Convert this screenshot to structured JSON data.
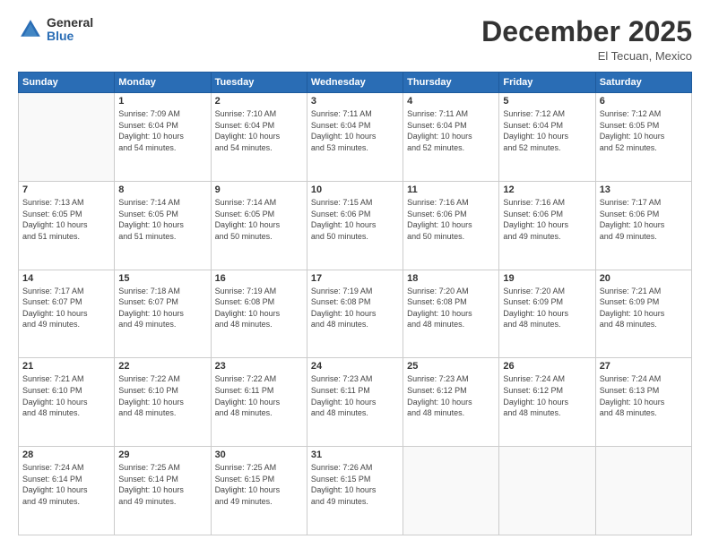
{
  "logo": {
    "general": "General",
    "blue": "Blue"
  },
  "title": "December 2025",
  "subtitle": "El Tecuan, Mexico",
  "header_days": [
    "Sunday",
    "Monday",
    "Tuesday",
    "Wednesday",
    "Thursday",
    "Friday",
    "Saturday"
  ],
  "weeks": [
    [
      {
        "day": "",
        "info": ""
      },
      {
        "day": "1",
        "info": "Sunrise: 7:09 AM\nSunset: 6:04 PM\nDaylight: 10 hours\nand 54 minutes."
      },
      {
        "day": "2",
        "info": "Sunrise: 7:10 AM\nSunset: 6:04 PM\nDaylight: 10 hours\nand 54 minutes."
      },
      {
        "day": "3",
        "info": "Sunrise: 7:11 AM\nSunset: 6:04 PM\nDaylight: 10 hours\nand 53 minutes."
      },
      {
        "day": "4",
        "info": "Sunrise: 7:11 AM\nSunset: 6:04 PM\nDaylight: 10 hours\nand 52 minutes."
      },
      {
        "day": "5",
        "info": "Sunrise: 7:12 AM\nSunset: 6:04 PM\nDaylight: 10 hours\nand 52 minutes."
      },
      {
        "day": "6",
        "info": "Sunrise: 7:12 AM\nSunset: 6:05 PM\nDaylight: 10 hours\nand 52 minutes."
      }
    ],
    [
      {
        "day": "7",
        "info": "Sunrise: 7:13 AM\nSunset: 6:05 PM\nDaylight: 10 hours\nand 51 minutes."
      },
      {
        "day": "8",
        "info": "Sunrise: 7:14 AM\nSunset: 6:05 PM\nDaylight: 10 hours\nand 51 minutes."
      },
      {
        "day": "9",
        "info": "Sunrise: 7:14 AM\nSunset: 6:05 PM\nDaylight: 10 hours\nand 50 minutes."
      },
      {
        "day": "10",
        "info": "Sunrise: 7:15 AM\nSunset: 6:06 PM\nDaylight: 10 hours\nand 50 minutes."
      },
      {
        "day": "11",
        "info": "Sunrise: 7:16 AM\nSunset: 6:06 PM\nDaylight: 10 hours\nand 50 minutes."
      },
      {
        "day": "12",
        "info": "Sunrise: 7:16 AM\nSunset: 6:06 PM\nDaylight: 10 hours\nand 49 minutes."
      },
      {
        "day": "13",
        "info": "Sunrise: 7:17 AM\nSunset: 6:06 PM\nDaylight: 10 hours\nand 49 minutes."
      }
    ],
    [
      {
        "day": "14",
        "info": "Sunrise: 7:17 AM\nSunset: 6:07 PM\nDaylight: 10 hours\nand 49 minutes."
      },
      {
        "day": "15",
        "info": "Sunrise: 7:18 AM\nSunset: 6:07 PM\nDaylight: 10 hours\nand 49 minutes."
      },
      {
        "day": "16",
        "info": "Sunrise: 7:19 AM\nSunset: 6:08 PM\nDaylight: 10 hours\nand 48 minutes."
      },
      {
        "day": "17",
        "info": "Sunrise: 7:19 AM\nSunset: 6:08 PM\nDaylight: 10 hours\nand 48 minutes."
      },
      {
        "day": "18",
        "info": "Sunrise: 7:20 AM\nSunset: 6:08 PM\nDaylight: 10 hours\nand 48 minutes."
      },
      {
        "day": "19",
        "info": "Sunrise: 7:20 AM\nSunset: 6:09 PM\nDaylight: 10 hours\nand 48 minutes."
      },
      {
        "day": "20",
        "info": "Sunrise: 7:21 AM\nSunset: 6:09 PM\nDaylight: 10 hours\nand 48 minutes."
      }
    ],
    [
      {
        "day": "21",
        "info": "Sunrise: 7:21 AM\nSunset: 6:10 PM\nDaylight: 10 hours\nand 48 minutes."
      },
      {
        "day": "22",
        "info": "Sunrise: 7:22 AM\nSunset: 6:10 PM\nDaylight: 10 hours\nand 48 minutes."
      },
      {
        "day": "23",
        "info": "Sunrise: 7:22 AM\nSunset: 6:11 PM\nDaylight: 10 hours\nand 48 minutes."
      },
      {
        "day": "24",
        "info": "Sunrise: 7:23 AM\nSunset: 6:11 PM\nDaylight: 10 hours\nand 48 minutes."
      },
      {
        "day": "25",
        "info": "Sunrise: 7:23 AM\nSunset: 6:12 PM\nDaylight: 10 hours\nand 48 minutes."
      },
      {
        "day": "26",
        "info": "Sunrise: 7:24 AM\nSunset: 6:12 PM\nDaylight: 10 hours\nand 48 minutes."
      },
      {
        "day": "27",
        "info": "Sunrise: 7:24 AM\nSunset: 6:13 PM\nDaylight: 10 hours\nand 48 minutes."
      }
    ],
    [
      {
        "day": "28",
        "info": "Sunrise: 7:24 AM\nSunset: 6:14 PM\nDaylight: 10 hours\nand 49 minutes."
      },
      {
        "day": "29",
        "info": "Sunrise: 7:25 AM\nSunset: 6:14 PM\nDaylight: 10 hours\nand 49 minutes."
      },
      {
        "day": "30",
        "info": "Sunrise: 7:25 AM\nSunset: 6:15 PM\nDaylight: 10 hours\nand 49 minutes."
      },
      {
        "day": "31",
        "info": "Sunrise: 7:26 AM\nSunset: 6:15 PM\nDaylight: 10 hours\nand 49 minutes."
      },
      {
        "day": "",
        "info": ""
      },
      {
        "day": "",
        "info": ""
      },
      {
        "day": "",
        "info": ""
      }
    ]
  ]
}
